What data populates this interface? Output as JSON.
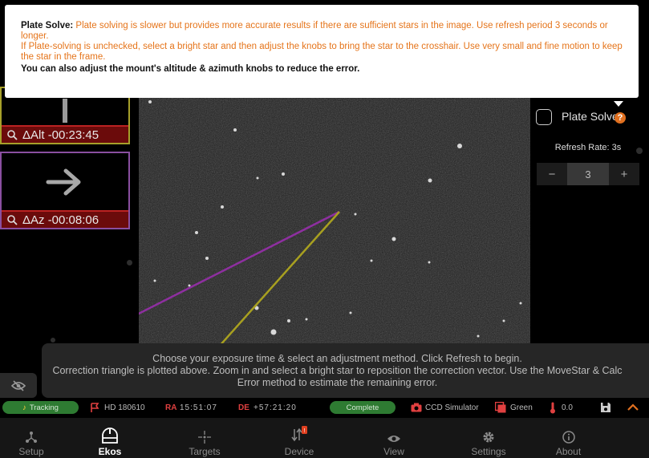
{
  "help_popup": {
    "title": "Plate Solve:",
    "line1": "Plate solving is slower but provides more accurate results if there are sufficient stars in the image. Use refresh period 3 seconds or longer.",
    "line2": "If Plate-solving is unchecked, select a bright star and then adjust the knobs to bring the star to the crosshair. Use very small and fine motion to keep the star in the frame.",
    "line3": "You can also adjust the mount's altitude & azimuth knobs to reduce the error."
  },
  "correction": {
    "alt_label": "ΔAlt -00:23:45",
    "az_label": "ΔAz -00:08:06"
  },
  "plate_solve": {
    "label": "Plate Solve",
    "help_icon": "?",
    "checked": false,
    "refresh_label": "Refresh Rate: 3s",
    "minus": "−",
    "value": "3",
    "plus": "+"
  },
  "instructions": {
    "line1": "Choose your exposure time & select an adjustment method. Click Refresh to begin.",
    "line2": "Correction triangle is plotted above. Zoom in and select a bright star to reposition the correction vector. Use the MoveStar & Calc Error method to estimate the remaining error."
  },
  "status_bar": {
    "tracking": "Tracking",
    "target": "HD 180610",
    "ra_label": "RA",
    "ra_value": "15:51:07",
    "de_label": "DE",
    "de_value": "+57:21:20",
    "complete": "Complete",
    "camera": "CCD Simulator",
    "filter": "Green",
    "temperature": "0.0"
  },
  "nav": [
    {
      "label": "Setup",
      "icon": "share-icon"
    },
    {
      "label": "Ekos",
      "icon": "observatory-icon"
    },
    {
      "label": "Targets",
      "icon": "crosshair-icon"
    },
    {
      "label": "Device",
      "icon": "device-icon"
    },
    {
      "label": "View",
      "icon": "eye-icon"
    },
    {
      "label": "Settings",
      "icon": "gear-icon"
    },
    {
      "label": "About",
      "icon": "info-icon"
    }
  ],
  "colors": {
    "accent_orange": "#e5741a",
    "alt_border": "#a6a02a",
    "az_border": "#8a4fa0",
    "label_red": "#6b0b0b",
    "pill_green": "#2e7b32",
    "alt_line": "#a8a020",
    "az_line": "#8e2fa0"
  }
}
